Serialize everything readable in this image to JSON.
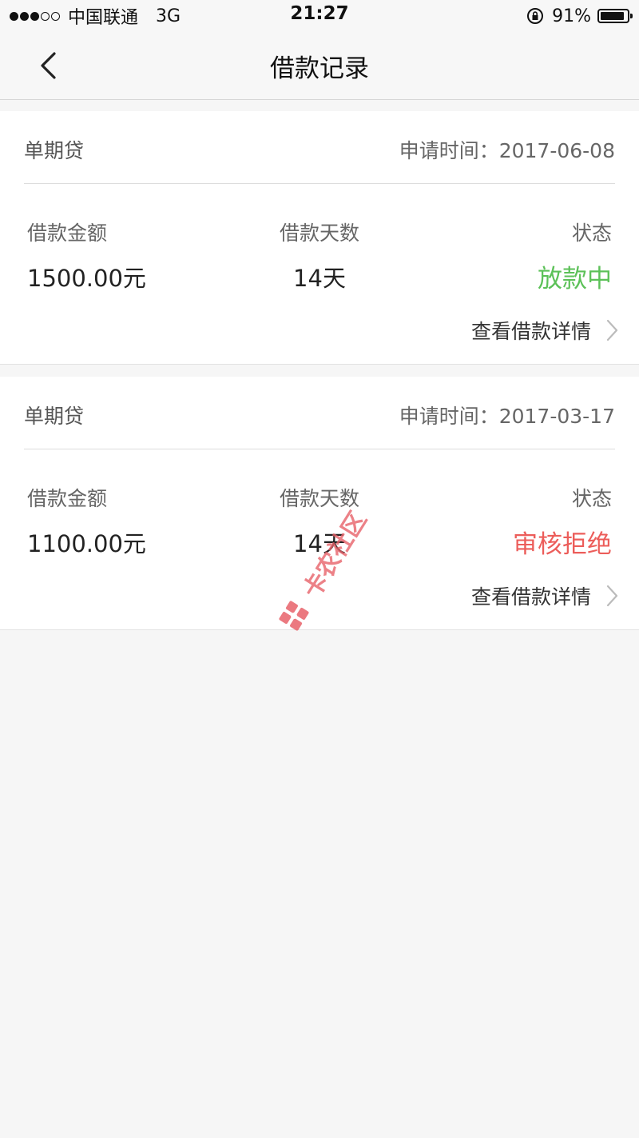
{
  "status_bar": {
    "signal_filled": 3,
    "signal_total": 5,
    "carrier": "中国联通",
    "network": "3G",
    "time": "21:27",
    "battery_percent": "91%",
    "battery_level": 0.91,
    "lock_icon": "rotation-lock-icon"
  },
  "nav": {
    "back_icon": "chevron-left-icon",
    "title": "借款记录"
  },
  "records": [
    {
      "product": "单期贷",
      "apply_time": "申请时间：2017-06-08",
      "amount_label": "借款金额",
      "amount": "1500.00元",
      "days_label": "借款天数",
      "days": "14天",
      "status_label": "状态",
      "status": "放款中",
      "status_color": "#5cc158",
      "detail_link": "查看借款详情"
    },
    {
      "product": "单期贷",
      "apply_time": "申请时间：2017-03-17",
      "amount_label": "借款金额",
      "amount": "1100.00元",
      "days_label": "借款天数",
      "days": "14天",
      "status_label": "状态",
      "status": "审核拒绝",
      "status_color": "#ec5d5a",
      "detail_link": "查看借款详情"
    }
  ],
  "watermark": {
    "text": "卡农社区",
    "color": "#e8626a"
  },
  "colors": {
    "background": "#f6f6f6",
    "card": "#ffffff",
    "chevron": "#bbbbbb"
  }
}
